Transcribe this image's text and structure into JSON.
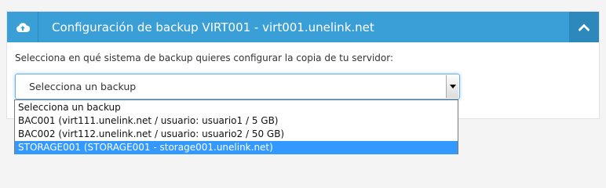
{
  "panel": {
    "title": "Configuración de backup VIRT001 - virt001.unelink.net",
    "header_icon": "cloud-upload-icon",
    "toggle_icon": "chevron-up-icon",
    "description": "Selecciona en qué sistema de backup quieres configurar la copia de tu servidor:"
  },
  "backup_select": {
    "value": "Selecciona un backup",
    "arrow_icon": "caret-down-icon",
    "options": [
      {
        "label": "Selecciona un backup",
        "selected": false
      },
      {
        "label": "BAC001 (virt111.unelink.net / usuario: usuario1 / 5 GB)",
        "selected": false
      },
      {
        "label": "BAC002 (virt112.unelink.net / usuario: usuario2 / 50 GB)",
        "selected": false
      },
      {
        "label": "STORAGE001 (STORAGE001 - storage001.unelink.net)",
        "selected": true
      }
    ]
  },
  "colors": {
    "header_bg": "#3a9fd6",
    "header_toggle_bg": "#2d88bb",
    "option_highlight": "#3399ff",
    "focus_border": "#66afe9"
  }
}
